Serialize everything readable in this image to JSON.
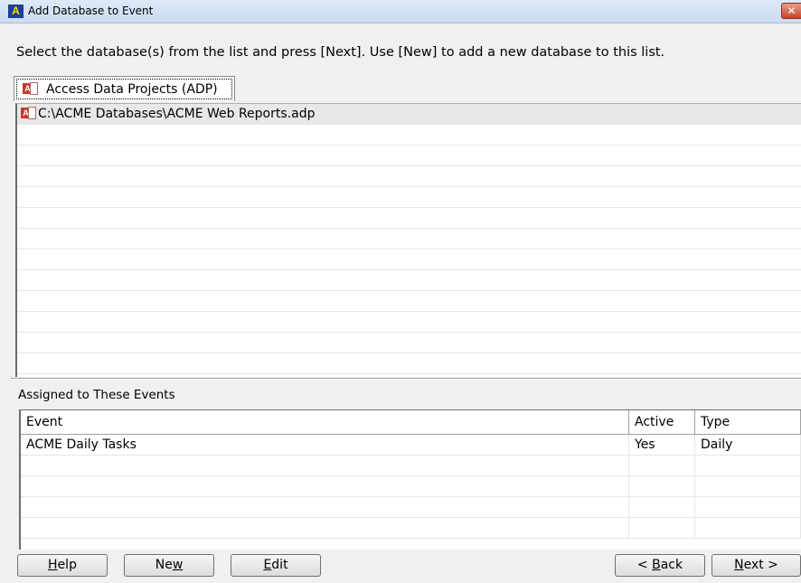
{
  "window": {
    "title": "Add Database to Event",
    "app_icon_text": "A",
    "close_glyph": "✕"
  },
  "instruction": "Select the database(s) from the list and press [Next]. Use [New] to add a new database to this list.",
  "tab": {
    "label": "Access Data Projects (ADP)",
    "icon": "adp-file-icon"
  },
  "databases": [
    {
      "path": "C:\\ACME Databases\\ACME Web Reports.adp",
      "icon": "adp-file-icon",
      "selected": true
    }
  ],
  "events_section": {
    "label": "Assigned to These Events",
    "columns": [
      "Event",
      "Active",
      "Type"
    ],
    "rows": [
      {
        "event": "ACME Daily Tasks",
        "active": "Yes",
        "type": "Daily"
      }
    ]
  },
  "buttons": {
    "help": {
      "pre": "",
      "key": "H",
      "post": "elp"
    },
    "new": {
      "pre": "Ne",
      "key": "w",
      "post": ""
    },
    "edit": {
      "pre": "",
      "key": "E",
      "post": "dit"
    },
    "back": {
      "pre": "< ",
      "key": "B",
      "post": "ack"
    },
    "next": {
      "pre": "",
      "key": "N",
      "post": "ext >"
    }
  },
  "colors": {
    "app_icon_bg": "#1c3f94",
    "close_button": "#c7442c",
    "selection": "#e8e8e8"
  }
}
